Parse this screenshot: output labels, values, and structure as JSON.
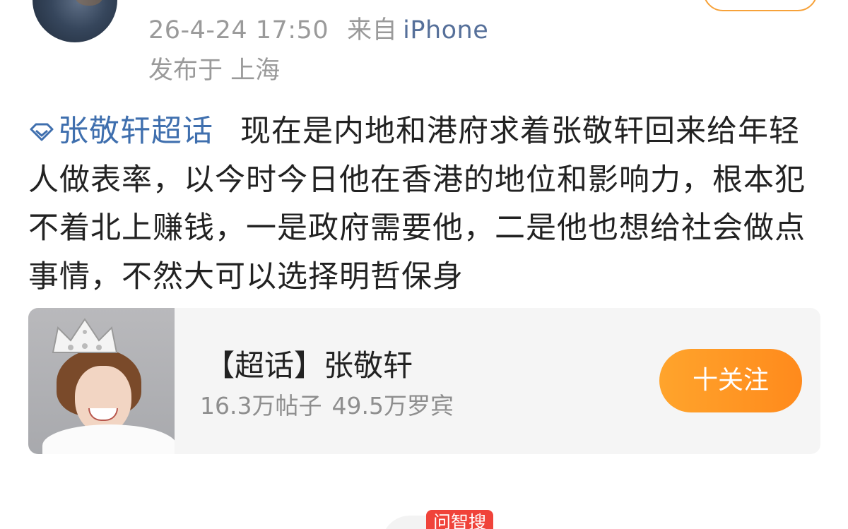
{
  "post": {
    "timestamp": "26-4-24 17:50",
    "source_label": "来自",
    "device": "iPhone",
    "location": "发布于 上海",
    "topic": "张敬轩超话",
    "text": "现在是内地和港府求着张敬轩回来给年轻人做表率，以今时今日他在香港的地位和影响力，根本犯不着北上赚钱，一是政府需要他，二是他也想给社会做点事情，不然大可以选择明哲保身"
  },
  "card": {
    "title": "【超话】张敬轩",
    "posts": "16.3万帖子",
    "members": "49.5万罗宾",
    "follow_label": "十关注"
  },
  "badge": {
    "label": "问智搜"
  },
  "colors": {
    "link": "#3f6fae",
    "accent": "#ff9626",
    "badge": "#f0433a"
  },
  "icons": [
    "avatar",
    "diamond-topic-icon",
    "topic-thumbnail"
  ]
}
